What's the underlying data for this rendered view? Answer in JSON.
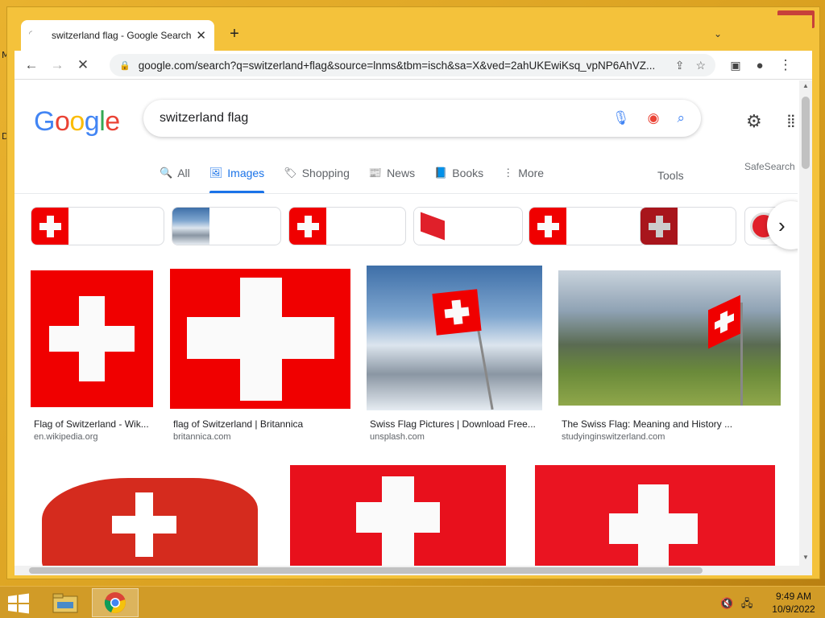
{
  "desktop": {
    "edge_letters": [
      "M",
      "D"
    ]
  },
  "window": {
    "minimize": "─",
    "maximize": "□",
    "close": "✕"
  },
  "browser": {
    "tab_title": "switzerland flag - Google Search",
    "tab_close": "✕",
    "new_tab": "+",
    "tab_menu": "⌄",
    "url": "google.com/search?q=switzerland+flag&source=lnms&tbm=isch&sa=X&ved=2ahUKEwiKsq_vpNP6AhVZ...",
    "lock_icon": "lock-icon"
  },
  "search": {
    "logo": [
      "G",
      "o",
      "o",
      "g",
      "l",
      "e"
    ],
    "logo_colors": [
      "#4285f4",
      "#ea4335",
      "#fbbc05",
      "#4285f4",
      "#34a853",
      "#ea4335"
    ],
    "query": "switzerland flag",
    "tabs": [
      {
        "label": "All",
        "icon": "🔍"
      },
      {
        "label": "Images",
        "icon": "🖼"
      },
      {
        "label": "Shopping",
        "icon": "🏷"
      },
      {
        "label": "News",
        "icon": "📰"
      },
      {
        "label": "Books",
        "icon": "📘"
      },
      {
        "label": "More",
        "icon": "⋮"
      }
    ],
    "tools": "Tools",
    "safesearch": "SafeSearch"
  },
  "results": [
    {
      "title": "Flag of Switzerland - Wik...",
      "source": "en.wikipedia.org"
    },
    {
      "title": "flag of Switzerland | Britannica",
      "source": "britannica.com"
    },
    {
      "title": "Swiss Flag Pictures | Download Free...",
      "source": "unsplash.com"
    },
    {
      "title": "The Swiss Flag: Meaning and History ...",
      "source": "studyinginswitzerland.com"
    }
  ],
  "taskbar": {
    "time": "9:49 AM",
    "date": "10/9/2022"
  },
  "colors": {
    "accent": "#1a73e8",
    "flag_red": "#f00000",
    "taskbar": "#d19b27"
  }
}
